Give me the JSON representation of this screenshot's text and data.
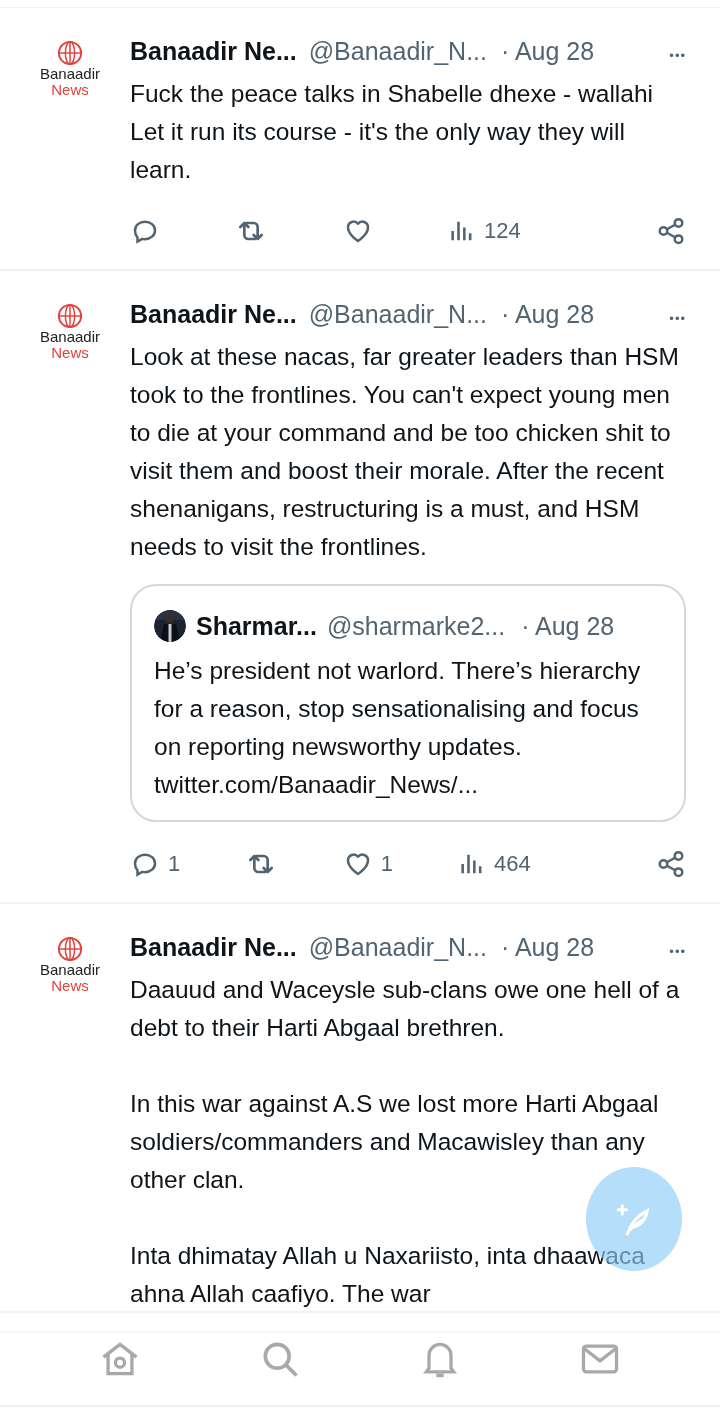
{
  "tweets": [
    {
      "avatar": {
        "line_1": "Banaadir",
        "line_2": "News"
      },
      "name": "Banaadir Ne...",
      "handle": "@Banaadir_N...",
      "date": "· Aug 28",
      "more": "•••",
      "paragraphs": [
        "Fuck the peace talks in Shabelle dhexe - wallahi Let it run its course - it's the only way they will learn."
      ],
      "actions": [
        {
          "kind": "reply"
        },
        {
          "kind": "repost"
        },
        {
          "kind": "like"
        },
        {
          "kind": "views",
          "count": "124"
        },
        {
          "kind": "share"
        }
      ]
    },
    {
      "avatar": {
        "line_1": "Banaadir",
        "line_2": "News"
      },
      "name": "Banaadir Ne...",
      "handle": "@Banaadir_N...",
      "date": "· Aug 28",
      "more": "•••",
      "paragraphs": [
        "Look at these nacas, far greater leaders than HSM took to the frontlines. You can't expect young men to die at your command and be too chicken shit to visit them and boost their morale. After the recent shenanigans, restructuring is a must, and HSM needs to visit the frontlines."
      ],
      "quote": {
        "name": "Sharmar...",
        "handle": "@sharmarke2...",
        "date": "· Aug 28",
        "text": "He’s president not warlord. There’s hierarchy for a reason, stop sensationalising and focus on reporting newsworthy updates.",
        "link": "twitter.com/Banaadir_News/..."
      },
      "actions": [
        {
          "kind": "reply",
          "count": "1"
        },
        {
          "kind": "repost"
        },
        {
          "kind": "like",
          "count": "1"
        },
        {
          "kind": "views",
          "count": "464"
        },
        {
          "kind": "share"
        }
      ]
    },
    {
      "avatar": {
        "line_1": "Banaadir",
        "line_2": "News"
      },
      "name": "Banaadir Ne...",
      "handle": "@Banaadir_N...",
      "date": "· Aug 28",
      "more": "•••",
      "paragraphs": [
        "Daauud and Waceysle sub-clans owe one hell of a debt to their Harti Abgaal brethren.",
        "In this war against A.S we lost more Harti Abgaal soldiers/commanders and Macawisley than any other clan.",
        "Inta dhimatay Allah u Naxariisto, inta dhaawaca ahna Allah caafiyo. The war"
      ]
    }
  ],
  "nav": [
    {
      "kind": "home"
    },
    {
      "kind": "search"
    },
    {
      "kind": "bell"
    },
    {
      "kind": "mail"
    }
  ],
  "compose_button": {
    "kind": "compose"
  }
}
